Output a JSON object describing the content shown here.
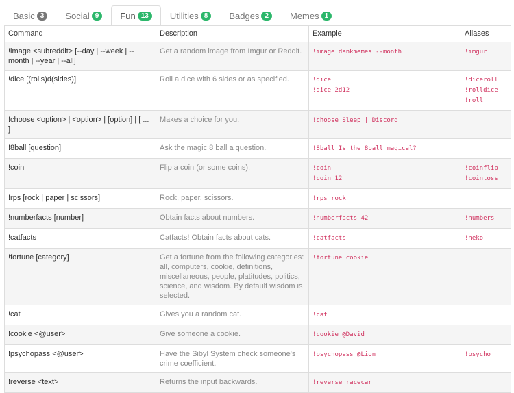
{
  "tabs": [
    {
      "label": "Basic",
      "count": "3",
      "badge_color": "#777777",
      "active": false
    },
    {
      "label": "Social",
      "count": "9",
      "badge_color": "#2cb76b",
      "active": false
    },
    {
      "label": "Fun",
      "count": "13",
      "badge_color": "#2cb76b",
      "active": true
    },
    {
      "label": "Utilities",
      "count": "8",
      "badge_color": "#2cb76b",
      "active": false
    },
    {
      "label": "Badges",
      "count": "2",
      "badge_color": "#2cb76b",
      "active": false
    },
    {
      "label": "Memes",
      "count": "1",
      "badge_color": "#2cb76b",
      "active": false
    }
  ],
  "table": {
    "headers": [
      "Command",
      "Description",
      "Example",
      "Aliases"
    ],
    "rows": [
      {
        "command": "!image <subreddit> [--day | --week | --month | --year | --all]",
        "description": "Get a random image from Imgur or Reddit.",
        "examples": [
          "!image dankmemes --month"
        ],
        "aliases": [
          "!imgur"
        ]
      },
      {
        "command": "!dice [(rolls)d(sides)]",
        "description": "Roll a dice with 6 sides or as specified.",
        "examples": [
          "!dice",
          "!dice 2d12"
        ],
        "aliases": [
          "!diceroll",
          "!rolldice",
          "!roll"
        ]
      },
      {
        "command": "!choose <option> | <option> | [option] | [ ... ]",
        "description": "Makes a choice for you.",
        "examples": [
          "!choose Sleep | Discord"
        ],
        "aliases": []
      },
      {
        "command": "!8ball [question]",
        "description": "Ask the magic 8 ball a question.",
        "examples": [
          "!8ball Is the 8ball magical?"
        ],
        "aliases": []
      },
      {
        "command": "!coin",
        "description": "Flip a coin (or some coins).",
        "examples": [
          "!coin",
          "!coin 12"
        ],
        "aliases": [
          "!coinflip",
          "!cointoss"
        ]
      },
      {
        "command": "!rps [rock | paper | scissors]",
        "description": "Rock, paper, scissors.",
        "examples": [
          "!rps rock"
        ],
        "aliases": []
      },
      {
        "command": "!numberfacts [number]",
        "description": "Obtain facts about numbers.",
        "examples": [
          "!numberfacts 42"
        ],
        "aliases": [
          "!numbers"
        ]
      },
      {
        "command": "!catfacts",
        "description": "Catfacts! Obtain facts about cats.",
        "examples": [
          "!catfacts"
        ],
        "aliases": [
          "!neko"
        ]
      },
      {
        "command": "!fortune [category]",
        "description": "Get a fortune from the following categories: all, computers, cookie, definitions, miscellaneous, people, platitudes, politics, science, and wisdom. By default wisdom is selected.",
        "examples": [
          "!fortune cookie"
        ],
        "aliases": []
      },
      {
        "command": "!cat",
        "description": "Gives you a random cat.",
        "examples": [
          "!cat"
        ],
        "aliases": []
      },
      {
        "command": "!cookie <@user>",
        "description": "Give someone a cookie.",
        "examples": [
          "!cookie @David"
        ],
        "aliases": []
      },
      {
        "command": "!psychopass <@user>",
        "description": "Have the Sibyl System check someone's crime coefficient.",
        "examples": [
          "!psychopass @Lion"
        ],
        "aliases": [
          "!psycho"
        ]
      },
      {
        "command": "!reverse <text>",
        "description": "Returns the input backwards.",
        "examples": [
          "!reverse racecar"
        ],
        "aliases": []
      }
    ]
  }
}
